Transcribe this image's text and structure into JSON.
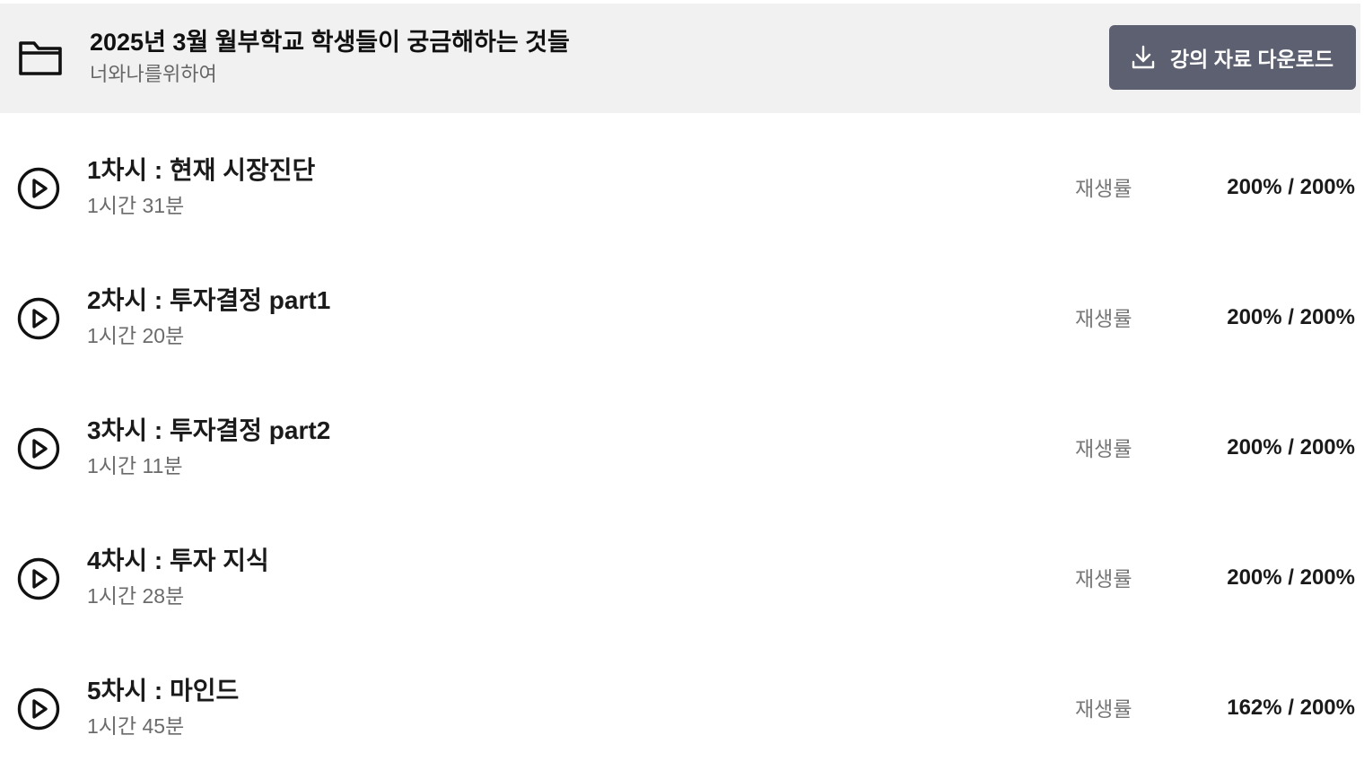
{
  "header": {
    "folder_icon": "folder-icon",
    "title": "2025년 3월 월부학교 학생들이 궁금해하는 것들",
    "instructor": "너와나를위하여",
    "download_button": {
      "icon": "download-icon",
      "label": "강의 자료 다운로드",
      "color": "#5d6070"
    }
  },
  "lessons": [
    {
      "icon": "play-circle-icon",
      "title": "1차시 : 현재 시장진단",
      "duration": "1시간 31분",
      "progress_label": "재생률",
      "progress": "200% / 200%"
    },
    {
      "icon": "play-circle-icon",
      "title": "2차시 : 투자결정 part1",
      "duration": "1시간 20분",
      "progress_label": "재생률",
      "progress": "200% / 200%"
    },
    {
      "icon": "play-circle-icon",
      "title": "3차시 : 투자결정 part2",
      "duration": "1시간 11분",
      "progress_label": "재생률",
      "progress": "200% / 200%"
    },
    {
      "icon": "play-circle-icon",
      "title": "4차시 : 투자 지식",
      "duration": "1시간 28분",
      "progress_label": "재생률",
      "progress": "200% / 200%"
    },
    {
      "icon": "play-circle-icon",
      "title": "5차시 : 마인드",
      "duration": "1시간 45분",
      "progress_label": "재생률",
      "progress": "162% / 200%"
    }
  ],
  "colors": {
    "header_bg": "#f1f1f1",
    "text_primary": "#1a1a1a",
    "text_secondary": "#6b6b6b"
  }
}
